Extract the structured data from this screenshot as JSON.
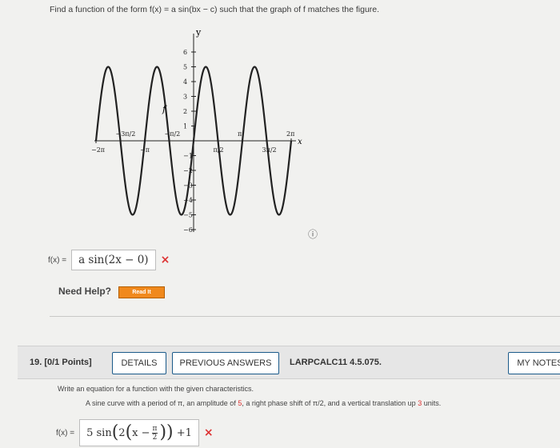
{
  "question18": {
    "prompt": "Find a function of the form f(x) = a sin(bx − c) such that the graph of f matches the figure.",
    "fx_label": "f(x) =",
    "answer": "a sin(2x − 0)",
    "result_mark": "×",
    "need_help": "Need Help?",
    "read_it": "Read It",
    "info_icon": "ⓘ"
  },
  "graph": {
    "y_axis_label": "y",
    "x_axis_label": "x",
    "curve_label": "f",
    "x_tick_labels": [
      "−2π",
      "−3π/2",
      "−π",
      "−π/2",
      "π/2",
      "π",
      "3π/2",
      "2π"
    ],
    "y_tick_labels": [
      "6",
      "5",
      "4",
      "3",
      "2",
      "1",
      "−1",
      "−2",
      "−3",
      "−4",
      "−5",
      "−6"
    ],
    "function_amplitude": 5,
    "function_b": 2,
    "x_range": [
      -6.283,
      6.283
    ],
    "y_range": [
      -6,
      6
    ]
  },
  "question19": {
    "number": "19. [0/1 Points]",
    "details_btn": "DETAILS",
    "previous_answers_btn": "PREVIOUS ANSWERS",
    "course_code": "LARPCALC11 4.5.075.",
    "my_notes_btn": "MY NOTES",
    "instruction": "Write an equation for a function with the given characteristics.",
    "desc_prefix": "A sine curve with a period of π, an amplitude of ",
    "amplitude": "5",
    "desc_mid": ", a right phase shift of π/2, and a vertical translation up ",
    "vertical": "3",
    "desc_suffix": " units.",
    "fx_label": "f(x) =",
    "answer_coef": "5",
    "answer_sin": "sin",
    "answer_inner_b": "2",
    "answer_inner_x": "x −",
    "answer_frac_num": "π",
    "answer_frac_den": "2",
    "answer_tail": "+1",
    "result_mark": "×"
  }
}
